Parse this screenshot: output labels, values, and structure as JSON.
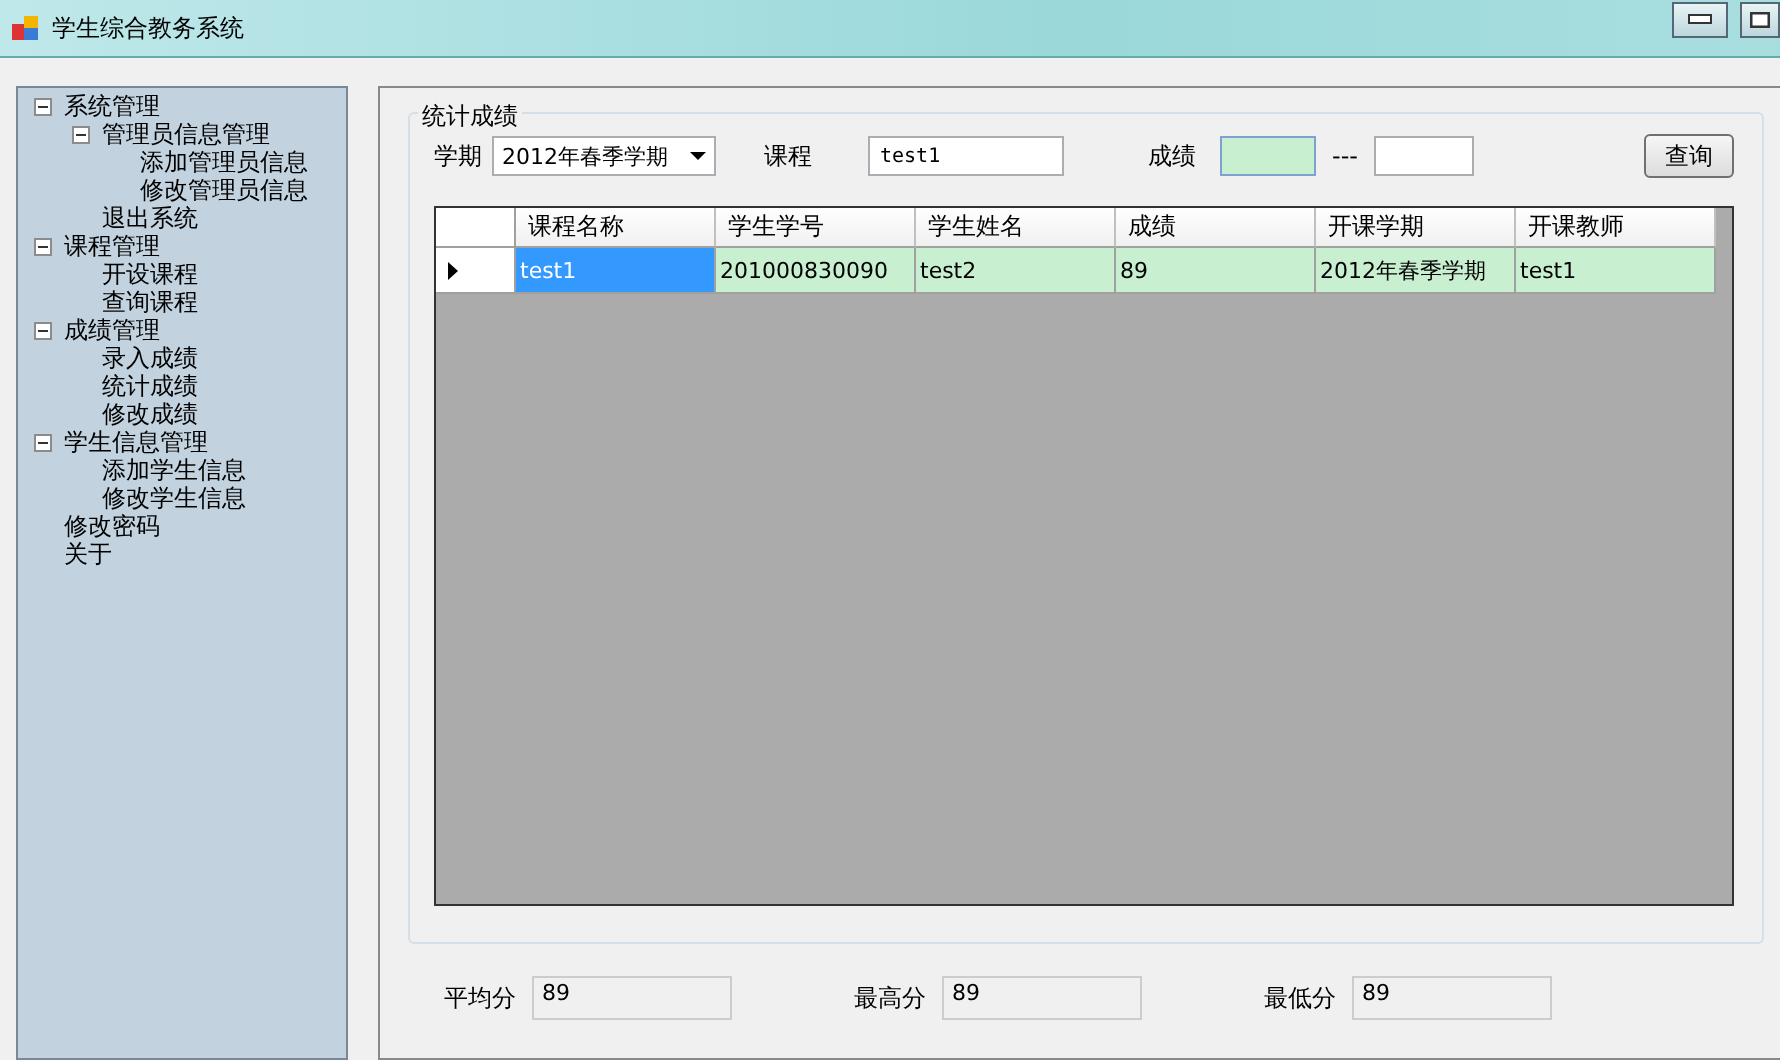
{
  "window": {
    "title": "学生综合教务系统"
  },
  "tree": [
    {
      "label": "系统管理",
      "expanded": true,
      "children": [
        {
          "label": "管理员信息管理",
          "expanded": true,
          "children": [
            {
              "label": "添加管理员信息"
            },
            {
              "label": "修改管理员信息"
            }
          ]
        },
        {
          "label": "退出系统"
        }
      ]
    },
    {
      "label": "课程管理",
      "expanded": true,
      "children": [
        {
          "label": "开设课程"
        },
        {
          "label": "查询课程"
        }
      ]
    },
    {
      "label": "成绩管理",
      "expanded": true,
      "children": [
        {
          "label": "录入成绩"
        },
        {
          "label": "统计成绩"
        },
        {
          "label": "修改成绩"
        }
      ]
    },
    {
      "label": "学生信息管理",
      "expanded": true,
      "children": [
        {
          "label": "添加学生信息"
        },
        {
          "label": "修改学生信息"
        }
      ]
    },
    {
      "label": "修改密码"
    },
    {
      "label": "关于"
    }
  ],
  "group": {
    "title": "统计成绩",
    "term": {
      "label": "学期",
      "value": "2012年春季学期"
    },
    "course": {
      "label": "课程",
      "value": "test1"
    },
    "score": {
      "label": "成绩",
      "from_focused": true,
      "separator": "---"
    },
    "query_button": "查询",
    "table": {
      "columns": [
        "课程名称",
        "学生学号",
        "学生姓名",
        "成绩",
        "开课学期",
        "开课教师"
      ],
      "rows": [
        {
          "current": true,
          "cells": [
            {
              "text": "test1",
              "selected": true
            },
            {
              "text": "201000830090",
              "selected": false
            },
            {
              "text": "test2",
              "selected": false
            },
            {
              "text": "89",
              "selected": false
            },
            {
              "text": "2012年春季学期",
              "selected": false
            },
            {
              "text": "test1",
              "selected": false
            }
          ]
        }
      ]
    }
  },
  "summary": [
    {
      "label": "平均分",
      "value": "89"
    },
    {
      "label": "最高分",
      "value": "89"
    },
    {
      "label": "最低分",
      "value": "89"
    }
  ]
}
